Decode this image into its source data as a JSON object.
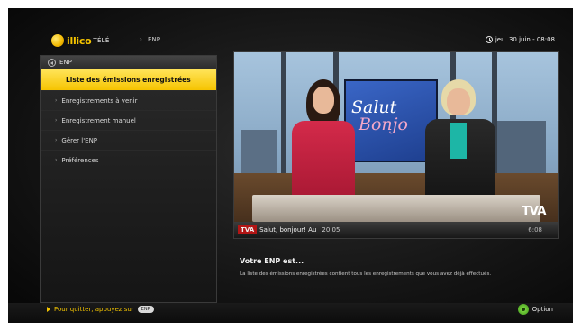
{
  "header": {
    "logo_name": "illico",
    "logo_sub": "TÉLÉ",
    "breadcrumb": "ENP",
    "datetime": "jeu. 30 juin - 08:08"
  },
  "menu": {
    "header_label": "ENP",
    "items": [
      {
        "label": "Liste des émissions enregistrées",
        "active": true
      },
      {
        "label": "Enregistrements à venir",
        "active": false
      },
      {
        "label": "Enregistrement manuel",
        "active": false
      },
      {
        "label": "Gérer l'ENP",
        "active": false
      },
      {
        "label": "Préférences",
        "active": false
      }
    ]
  },
  "preview": {
    "screen_line1": "Salut",
    "screen_line2": "Bonjo",
    "channel_logo": "TVA",
    "ticker_tag": "TVA",
    "ticker_text": "Salut, bonjour! Au",
    "ticker_nums": "20  05",
    "ticker_time": "6:08"
  },
  "description": {
    "title": "Votre ENP est...",
    "text": "La liste des émissions enregistrées contient tous les enregistrements que vous avez déjà effectués."
  },
  "footer": {
    "quit_label": "Pour quitter, appuyez sur",
    "quit_key": "ENP",
    "option_label": "Option"
  },
  "colors": {
    "accent": "#f6c400",
    "background": "#141414",
    "option_green": "#5bbf2a"
  }
}
